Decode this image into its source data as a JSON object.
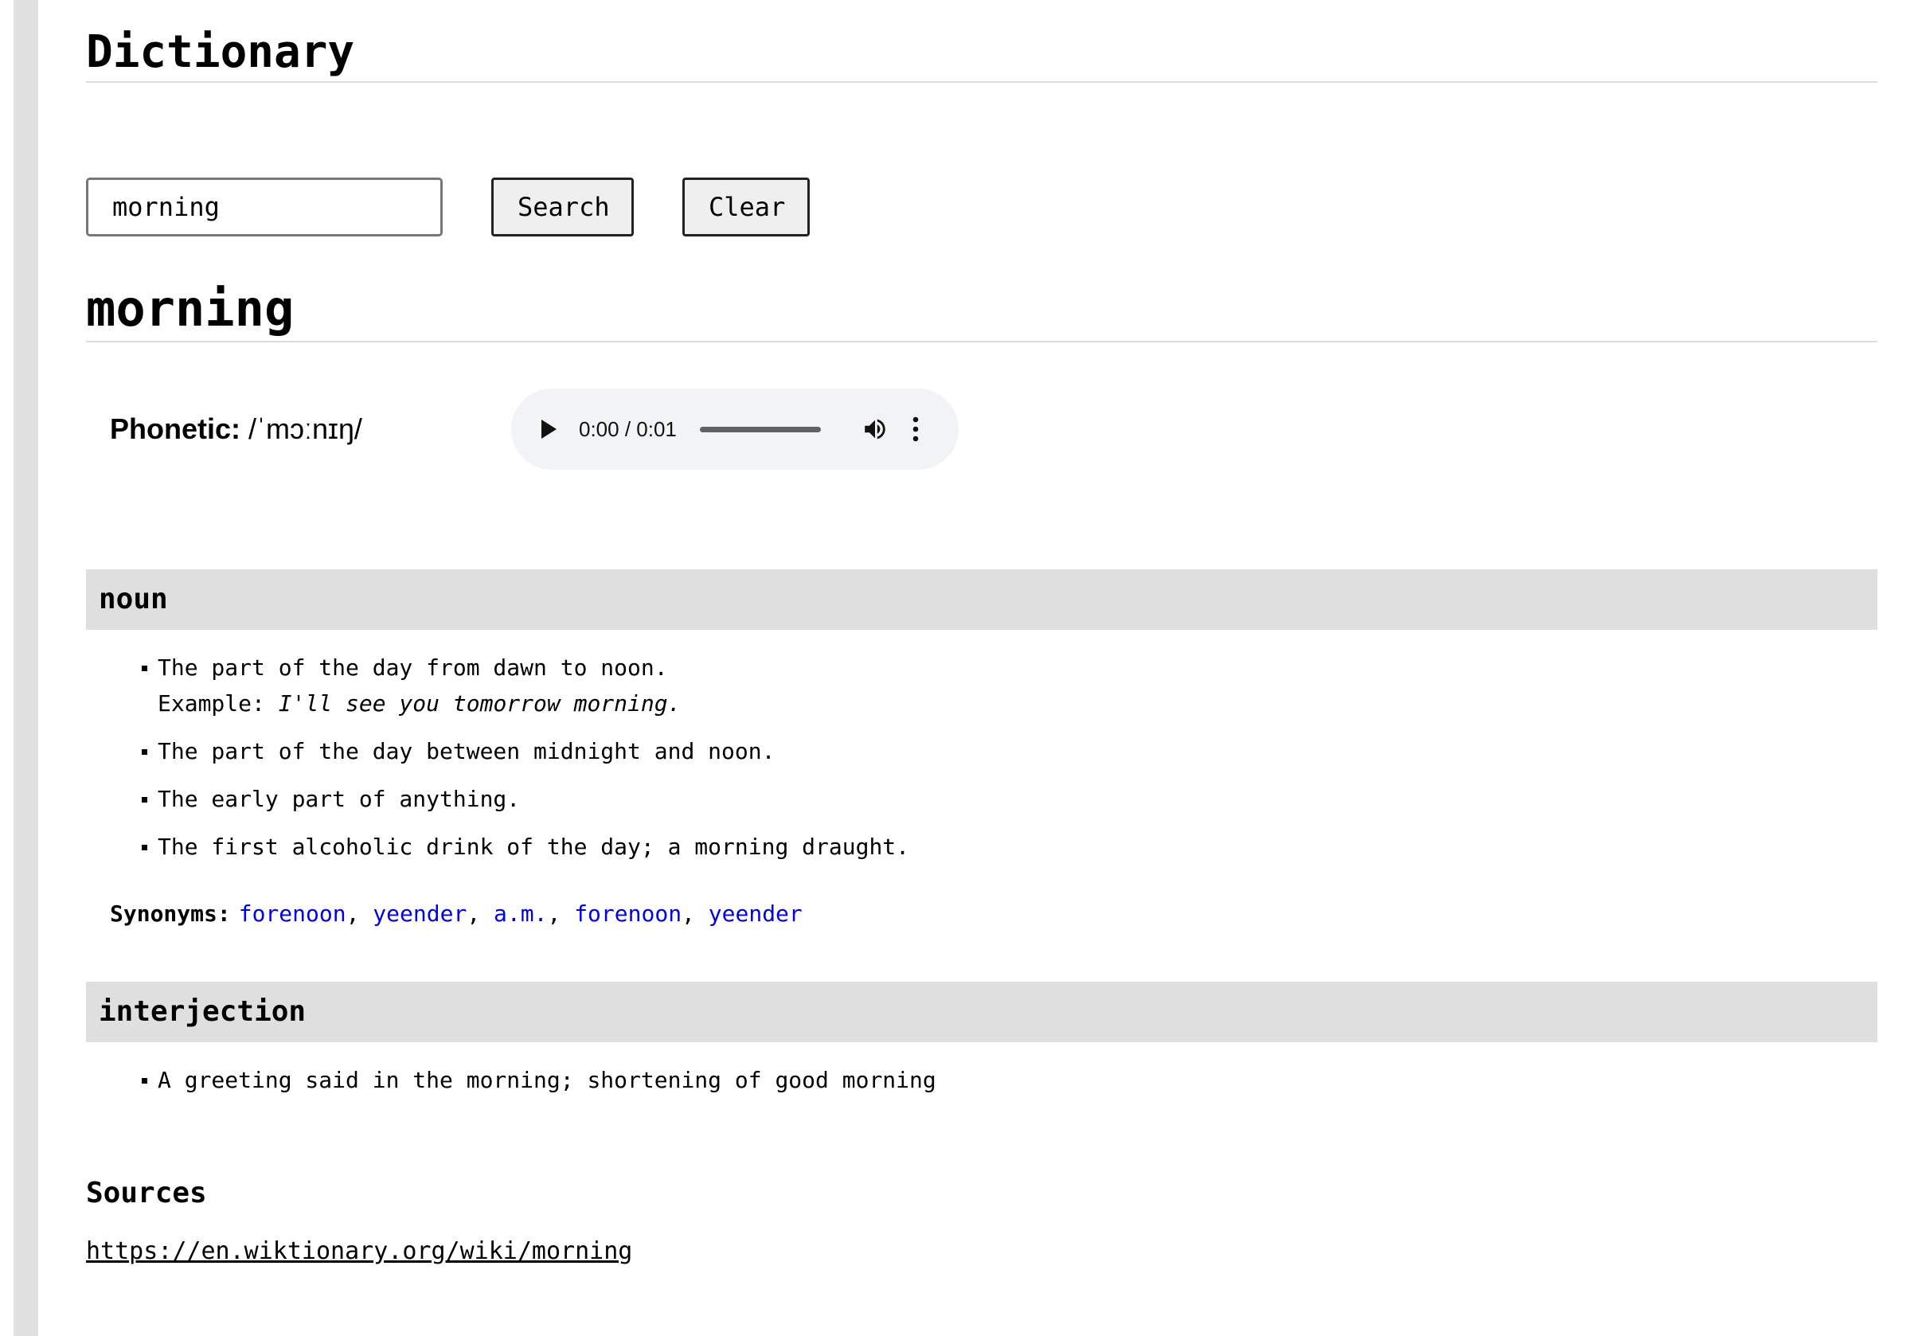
{
  "app": {
    "title": "Dictionary"
  },
  "search": {
    "value": "morning",
    "search_label": "Search",
    "clear_label": "Clear"
  },
  "entry": {
    "word": "morning",
    "phonetic_label": "Phonetic:",
    "phonetic": "/ˈmɔːnɪŋ/",
    "audio": {
      "time": "0:00 / 0:01",
      "play_icon": "play-icon",
      "volume_icon": "volume-icon",
      "more_icon": "more-vert-icon"
    },
    "meanings": [
      {
        "part_of_speech": "noun",
        "definitions": [
          {
            "text": "The part of the day from dawn to noon.",
            "example_label": "Example:",
            "example": "I'll see you tomorrow morning."
          },
          {
            "text": "The part of the day between midnight and noon."
          },
          {
            "text": "The early part of anything."
          },
          {
            "text": "The first alcoholic drink of the day; a morning draught."
          }
        ],
        "synonyms_label": "Synonyms:",
        "synonyms": [
          "forenoon",
          "yeender",
          "a.m.",
          "forenoon",
          "yeender"
        ]
      },
      {
        "part_of_speech": "interjection",
        "definitions": [
          {
            "text": "A greeting said in the morning; shortening of good morning"
          }
        ]
      }
    ]
  },
  "sources": {
    "title": "Sources",
    "links": [
      "https://en.wiktionary.org/wiki/morning"
    ]
  },
  "colors": {
    "link": "#0000ee",
    "pos_header_bg": "#dfdfdf",
    "audio_bg": "#f1f3f4",
    "rail": "#e0e0e0"
  }
}
